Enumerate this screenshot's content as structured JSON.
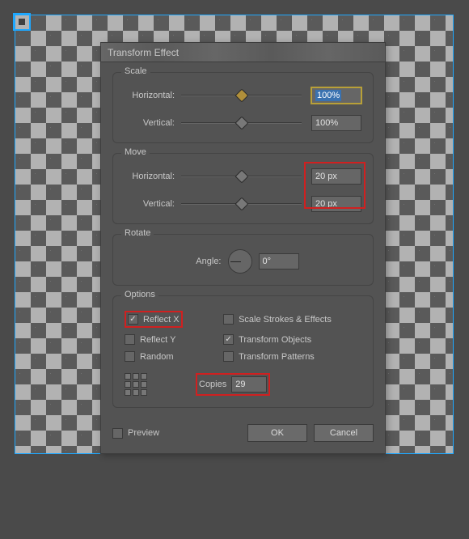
{
  "dialog": {
    "title": "Transform Effect",
    "scale": {
      "legend": "Scale",
      "horizontal_label": "Horizontal:",
      "horizontal_value": "100%",
      "vertical_label": "Vertical:",
      "vertical_value": "100%"
    },
    "move": {
      "legend": "Move",
      "horizontal_label": "Horizontal:",
      "horizontal_value": "20 px",
      "vertical_label": "Vertical:",
      "vertical_value": "20 px"
    },
    "rotate": {
      "legend": "Rotate",
      "angle_label": "Angle:",
      "angle_value": "0°"
    },
    "options": {
      "legend": "Options",
      "reflect_x": {
        "label": "Reflect X",
        "checked": true
      },
      "reflect_y": {
        "label": "Reflect Y",
        "checked": false
      },
      "random": {
        "label": "Random",
        "checked": false
      },
      "scale_strokes": {
        "label": "Scale Strokes & Effects",
        "checked": false
      },
      "transform_objects": {
        "label": "Transform Objects",
        "checked": true
      },
      "transform_patterns": {
        "label": "Transform Patterns",
        "checked": false
      },
      "copies_label": "Copies",
      "copies_value": "29"
    },
    "footer": {
      "preview_label": "Preview",
      "preview_checked": false,
      "ok_label": "OK",
      "cancel_label": "Cancel"
    }
  }
}
